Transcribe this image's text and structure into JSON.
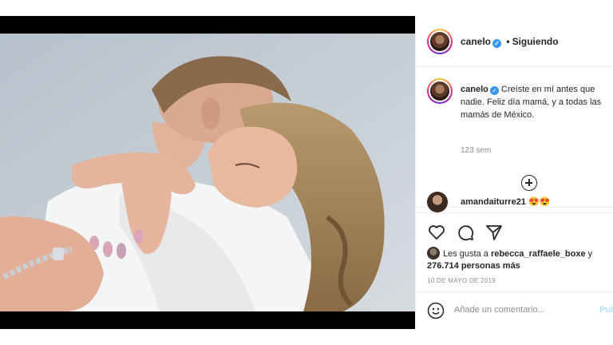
{
  "post": {
    "username": "canelo",
    "follow_status": "Siguiendo",
    "separator": "•",
    "caption": "Creíste en mí antes que nadie. Feliz día mamá, y a todas las mamás de México.",
    "time_ago": "123 sem"
  },
  "comments": [
    {
      "username": "amandaiturre21",
      "text": "😍😍"
    }
  ],
  "likes": {
    "prefix": "Les gusta a",
    "user": "rebecca_raffaele_boxe",
    "conjunction": "y",
    "count": "276.714 personas más"
  },
  "date": "10 DE MAYO DE 2019",
  "add_comment": {
    "placeholder": "Añade un comentario...",
    "publish_label": "Pub"
  },
  "icons": {
    "verified": "✓",
    "like": "heart-icon",
    "comment": "comment-icon",
    "share": "share-icon",
    "emoji": "emoji-icon",
    "load_more": "plus-circle-icon"
  },
  "colors": {
    "verified": "#3897f0",
    "muted": "#8e8e8e",
    "publish": "#b2dffc"
  }
}
